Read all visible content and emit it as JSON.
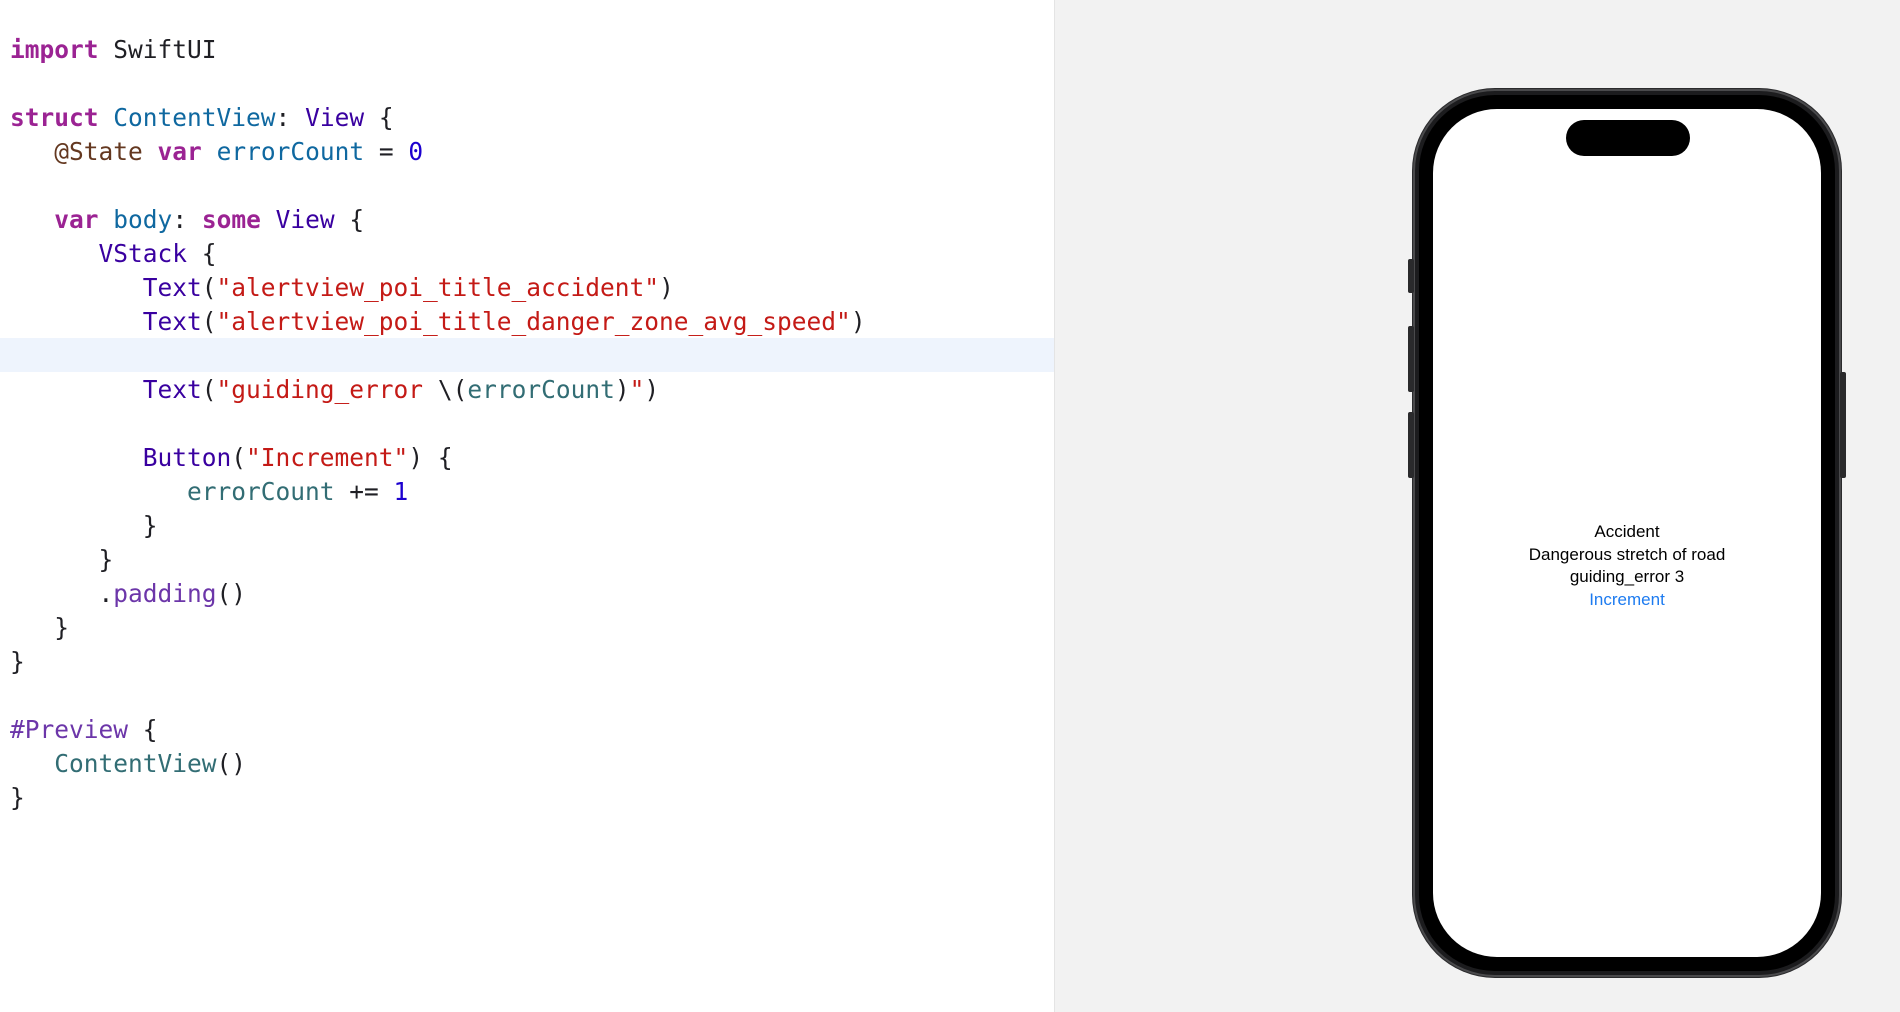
{
  "editor": {
    "lines": {
      "l1": {
        "a": "import",
        "b": " SwiftUI"
      },
      "l3": {
        "a": "struct",
        "b": " ",
        "c": "ContentView",
        "d": ": ",
        "e": "View",
        "f": " {"
      },
      "l4": {
        "indent": "   ",
        "a": "@State",
        "b": " ",
        "c": "var",
        "d": " ",
        "e": "errorCount",
        "f": " = ",
        "g": "0"
      },
      "l6": {
        "indent": "   ",
        "a": "var",
        "b": " ",
        "c": "body",
        "d": ": ",
        "e": "some",
        "f": " ",
        "g": "View",
        "h": " {"
      },
      "l7": {
        "indent": "      ",
        "a": "VStack",
        "b": " {"
      },
      "l8": {
        "indent": "         ",
        "a": "Text",
        "b": "(",
        "c": "\"alertview_poi_title_accident\"",
        "d": ")"
      },
      "l9": {
        "indent": "         ",
        "a": "Text",
        "b": "(",
        "c": "\"alertview_poi_title_danger_zone_avg_speed\"",
        "d": ")"
      },
      "l11": {
        "indent": "         ",
        "a": "Text",
        "b": "(",
        "c": "\"guiding_error ",
        "d": "\\(",
        "e": "errorCount",
        "f": ")",
        "g": "\"",
        "h": ")"
      },
      "l13": {
        "indent": "         ",
        "a": "Button",
        "b": "(",
        "c": "\"Increment\"",
        "d": ") {"
      },
      "l14": {
        "indent": "            ",
        "a": "errorCount",
        "b": " += ",
        "c": "1"
      },
      "l15": {
        "indent": "         ",
        "a": "}"
      },
      "l16": {
        "indent": "      ",
        "a": "}"
      },
      "l17": {
        "indent": "      ",
        "a": ".",
        "b": "padding",
        "c": "()"
      },
      "l18": {
        "indent": "   ",
        "a": "}"
      },
      "l19": {
        "a": "}"
      },
      "l21": {
        "a": "#Preview",
        "b": " {"
      },
      "l22": {
        "indent": "   ",
        "a": "ContentView",
        "b": "()"
      },
      "l23": {
        "a": "}"
      }
    }
  },
  "preview": {
    "line1": "Accident",
    "line2": "Dangerous stretch of road",
    "line3": "guiding_error 3",
    "button_label": "Increment"
  },
  "colors": {
    "keyword": "#9b2393",
    "type": "#3900a0",
    "string": "#c41a16",
    "number": "#1c00cf",
    "link_blue": "#1d7bf0",
    "canvas_bg": "#f2f2f2",
    "current_line": "#eef4fd"
  }
}
